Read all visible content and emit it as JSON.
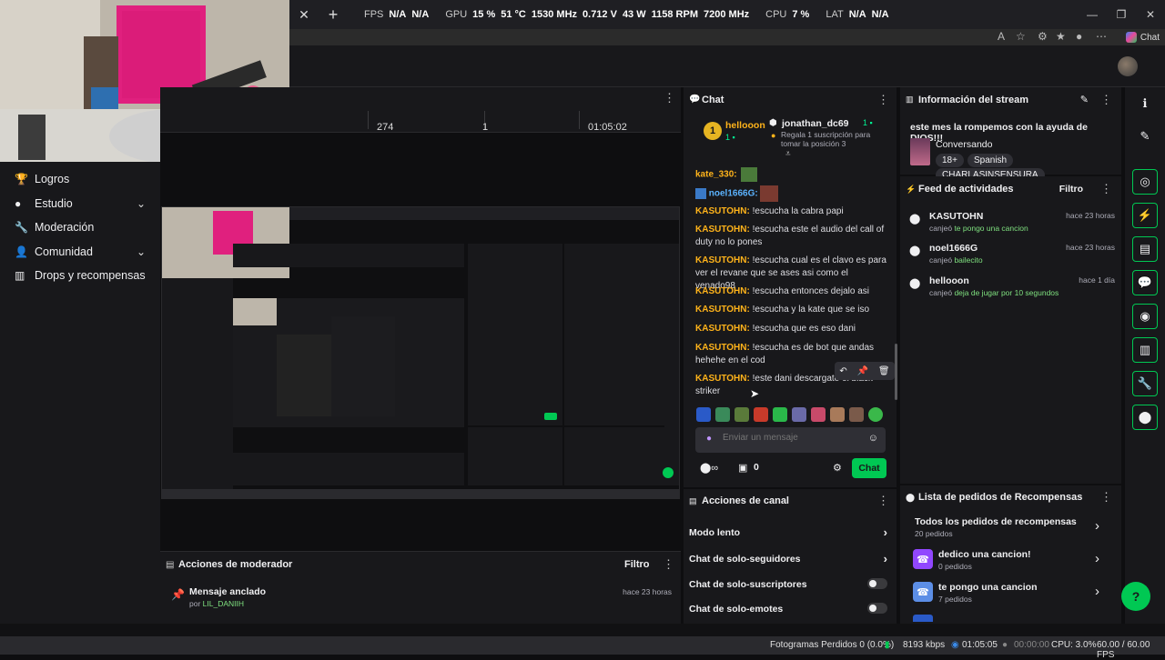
{
  "osd": {
    "fps_label": "FPS",
    "fps_val1": "N/A",
    "fps_val2": "N/A",
    "gpu_label": "GPU",
    "gpu_util": "15 %",
    "gpu_temp": "51 °C",
    "gpu_clock": "1530 MHz",
    "gpu_volt": "0.712 V",
    "gpu_power": "43 W",
    "gpu_fan": "1158 RPM",
    "gpu_mem": "7200 MHz",
    "cpu_label": "CPU",
    "cpu_val": "7 %",
    "lat_label": "LAT",
    "lat_val1": "N/A",
    "lat_val2": "N/A"
  },
  "browser": {
    "copilot_label": "Chat"
  },
  "nav": {
    "items": [
      {
        "label": "Logros",
        "icon": "trophy-icon"
      },
      {
        "label": "Estudio",
        "icon": "studio-icon"
      },
      {
        "label": "Moderación",
        "icon": "wrench-icon"
      },
      {
        "label": "Comunidad",
        "icon": "community-icon"
      },
      {
        "label": "Drops y recompensas",
        "icon": "gift-icon"
      }
    ]
  },
  "stats": {
    "viewers": "274",
    "followers": "1",
    "uptime": "01:05:02"
  },
  "mod_actions": {
    "title": "Acciones de moderador",
    "filter_label": "Filtro",
    "pinned_title": "Mensaje anclado",
    "pinned_by_prefix": "por",
    "pinned_by_user": "LIL_DANIIH",
    "pinned_time": "hace 23 horas"
  },
  "chat": {
    "title": "Chat",
    "leader_rank": "1",
    "leader_name": "hellooon",
    "leader_count": "1",
    "gift_user": "jonathan_dc69",
    "gift_count": "1",
    "gift_text": "Regala 1 suscripción para tomar la posición 3",
    "badge_msgs": [
      {
        "user": "kate_330:"
      },
      {
        "user": "noel1666G:"
      }
    ],
    "messages": [
      {
        "user": "KASUTOHN:",
        "text": " !escucha la cabra papi"
      },
      {
        "user": "KASUTOHN:",
        "text": " !escucha este el audio del call of duty no lo pones"
      },
      {
        "user": "KASUTOHN:",
        "text": " !escucha cual es el clavo es para ver el revane que se ases asi como el venado98"
      },
      {
        "user": "KASUTOHN:",
        "text": " !escucha entonces dejalo asi"
      },
      {
        "user": "KASUTOHN:",
        "text": " !escucha y la kate que se iso"
      },
      {
        "user": "KASUTOHN:",
        "text": " !escucha que es eso dani"
      },
      {
        "user": "KASUTOHN:",
        "text": " !escucha es de bot que andas hehehe en el cod"
      },
      {
        "user": "KASUTOHN:",
        "text": " !este dani descargate el black striker"
      }
    ],
    "input_placeholder": "Enviar un mensaje",
    "points_value": "0",
    "send_label": "Chat"
  },
  "channel_actions": {
    "title": "Acciones de canal",
    "rows": [
      "Modo lento",
      "Chat de solo-seguidores",
      "Chat de solo-suscriptores",
      "Chat de solo-emotes"
    ]
  },
  "stream_info": {
    "title": "Información del stream",
    "stream_title": "este mes la rompemos con la ayuda de DIOS!!!",
    "category": "Conversando",
    "tags": [
      "18+",
      "Spanish",
      "CHARLASINSENSURA"
    ]
  },
  "activity": {
    "title": "Feed de actividades",
    "filter_label": "Filtro",
    "items": [
      {
        "user": "KASUTOHN",
        "time": "hace 23 horas",
        "prefix": "canjeó",
        "reward": "te pongo una cancion"
      },
      {
        "user": "noel1666G",
        "time": "hace 23 horas",
        "prefix": "canjeó",
        "reward": "bailecito"
      },
      {
        "user": "hellooon",
        "time": "hace 1 día",
        "prefix": "canjeó",
        "reward": "deja de jugar por 10 segundos"
      }
    ]
  },
  "rewards": {
    "title": "Lista de pedidos de Recompensas",
    "all_title": "Todos los pedidos de recompensas",
    "all_count": "20 pedidos",
    "items": [
      {
        "name": "dedico una cancion!",
        "count": "0 pedidos",
        "color": "#9147ff"
      },
      {
        "name": "te pongo una cancion",
        "count": "7 pedidos",
        "color": "#5c8ee6"
      }
    ]
  },
  "statusbar": {
    "dropped": "Fotogramas Perdidos 0 (0.0%)",
    "bitrate": "8193 kbps",
    "live_time": "01:05:05",
    "rec_time": "00:00:00",
    "cpu": "CPU: 3.0%",
    "fps": "60.00 / 60.00 FPS"
  },
  "colors": {
    "accent": "#9147ff",
    "green": "#00f593",
    "chat_button": "#00c853",
    "username": "#ffb31a"
  }
}
